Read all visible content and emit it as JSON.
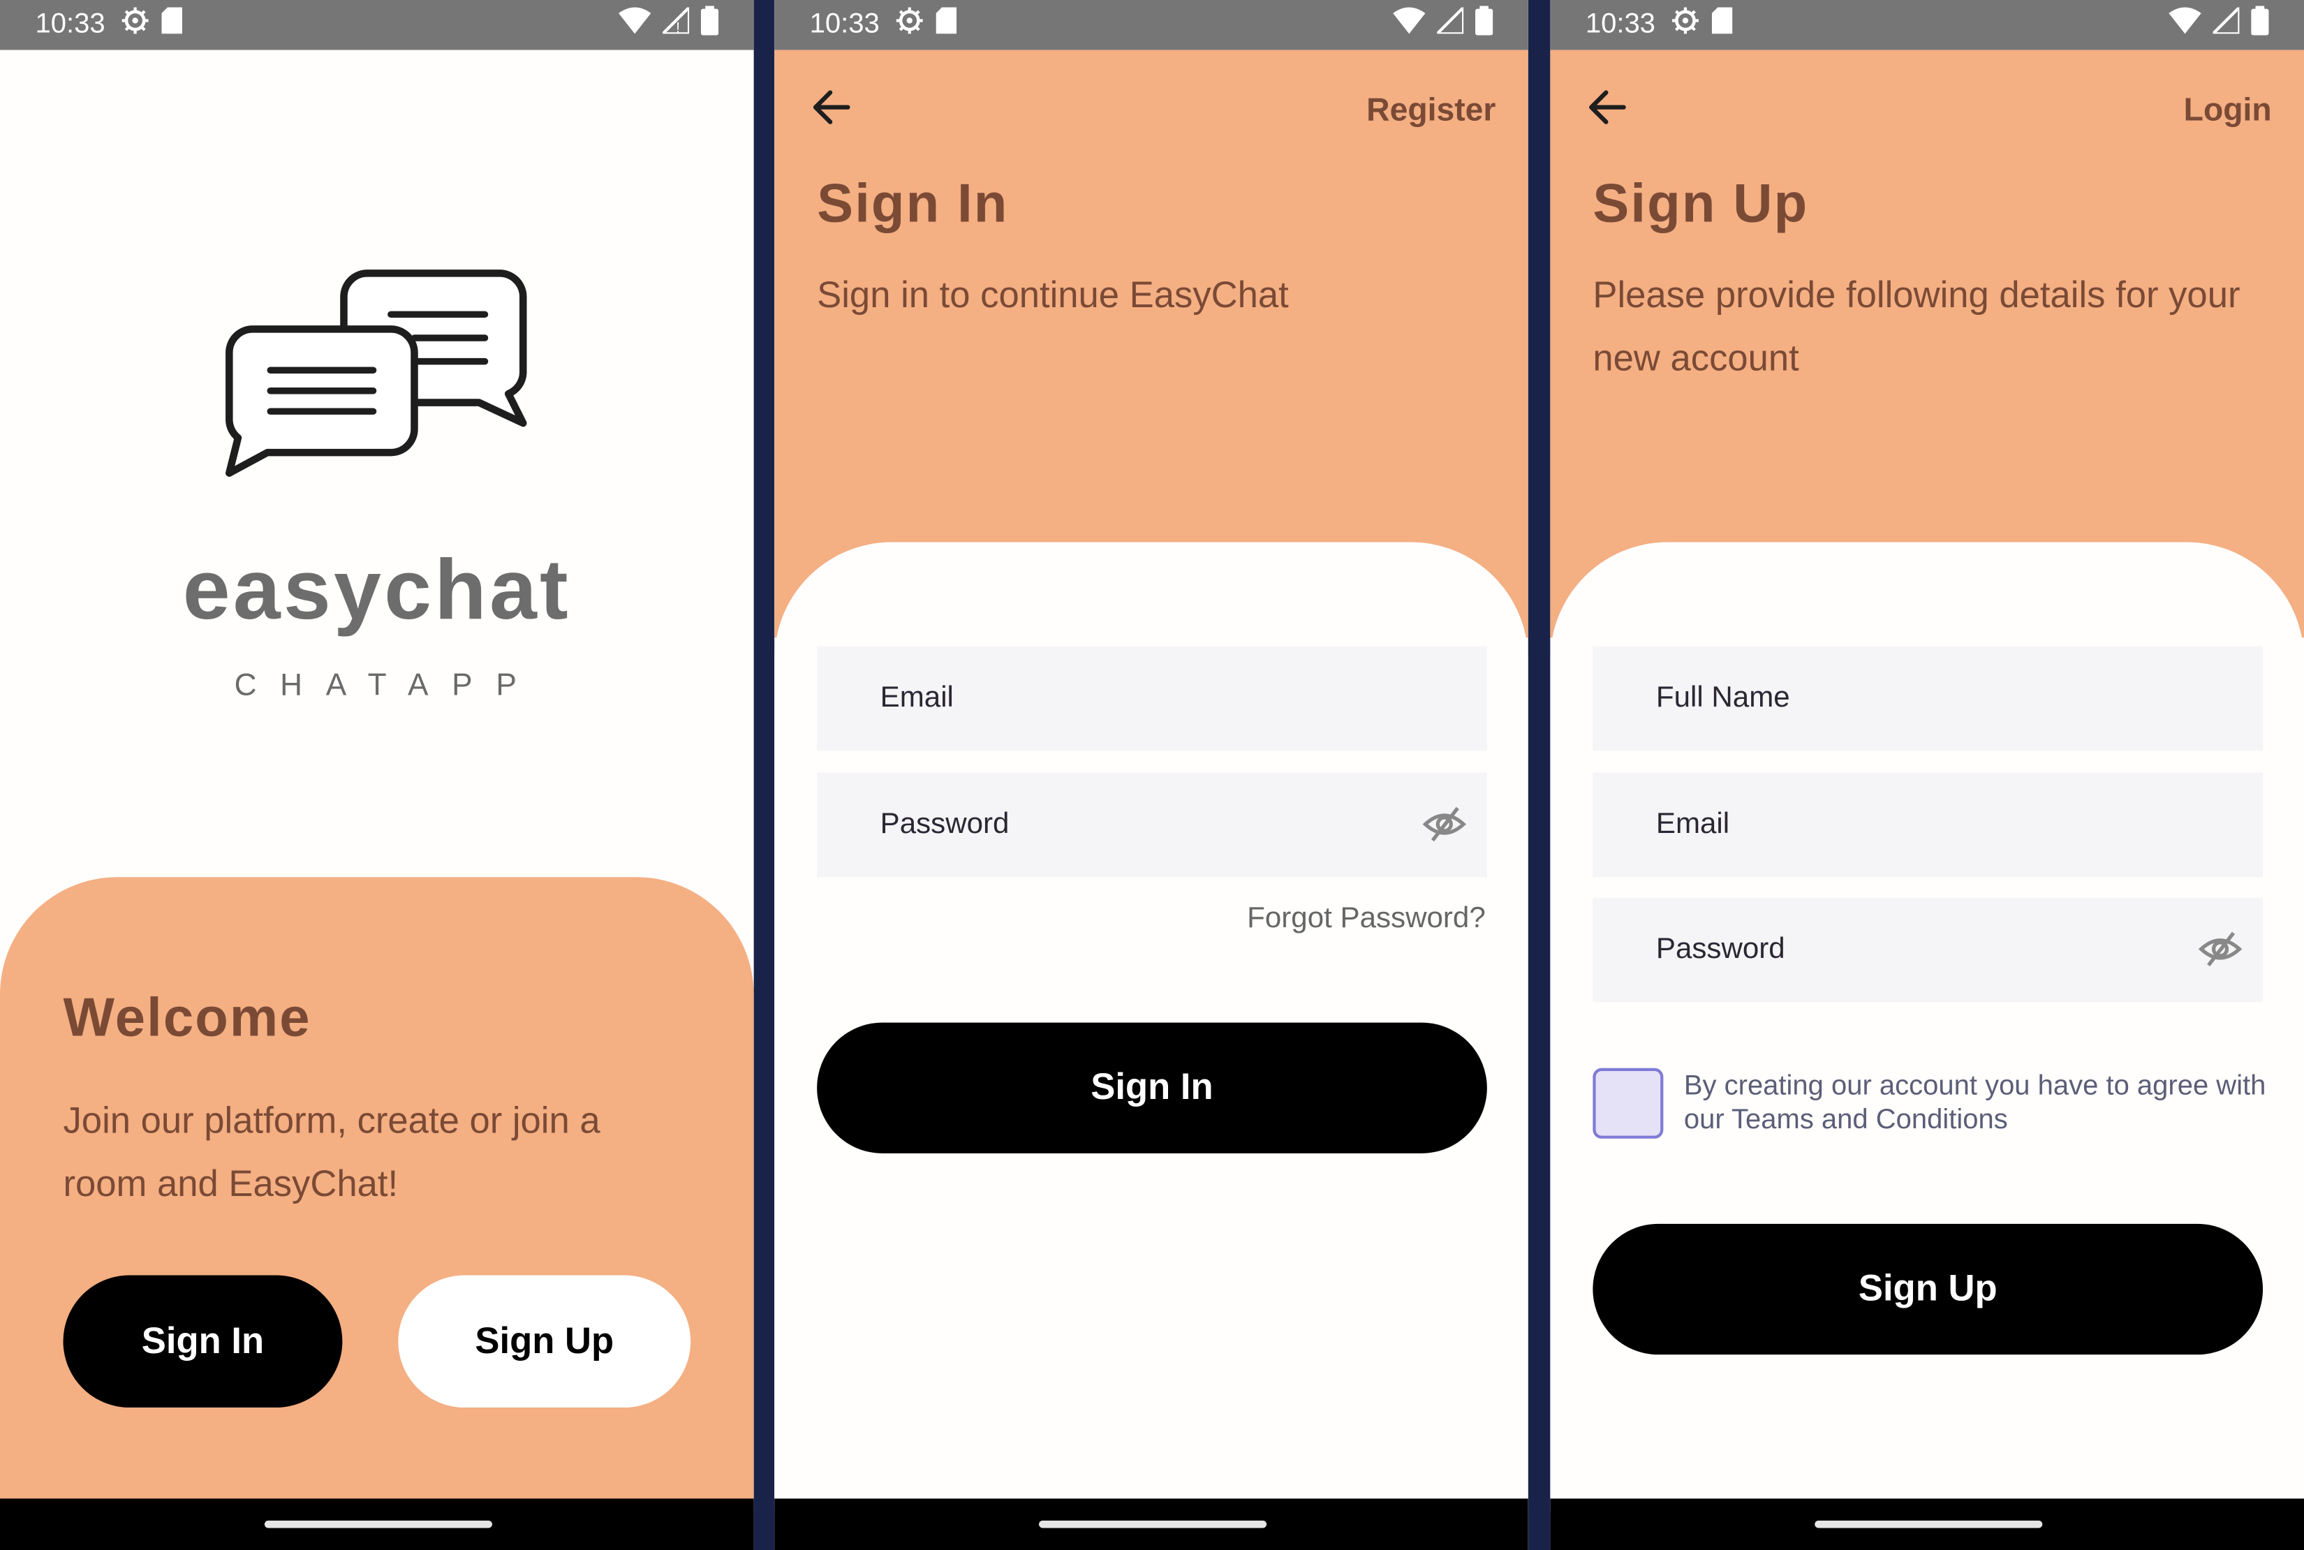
{
  "status_bar": {
    "time": "10:33"
  },
  "welcome_screen": {
    "brand": "easychat",
    "tagline": "CHATAPP",
    "title": "Welcome",
    "subtitle": "Join our platform, create or join a room and EasyChat!",
    "sign_in_label": "Sign In",
    "sign_up_label": "Sign Up"
  },
  "sign_in_screen": {
    "top_link": "Register",
    "title": "Sign In",
    "subtitle": "Sign in to continue EasyChat",
    "email_placeholder": "Email",
    "password_placeholder": "Password",
    "forgot_label": "Forgot Password?",
    "submit_label": "Sign In"
  },
  "sign_up_screen": {
    "top_link": "Login",
    "title": "Sign Up",
    "subtitle": "Please provide following details for your new account",
    "name_placeholder": "Full Name",
    "email_placeholder": "Email",
    "password_placeholder": "Password",
    "terms_text": "By creating our account you have to agree with our Teams and Conditions",
    "submit_label": "Sign Up"
  },
  "colors": {
    "accent_peach": "#f4af83",
    "heading_brown": "#7a4a35",
    "divider_navy": "#192349",
    "field_bg": "#f5f4f6"
  },
  "icons": [
    "settings-icon",
    "sd-card-icon",
    "wifi-icon",
    "signal-icon",
    "battery-icon",
    "chat-bubbles-icon",
    "back-arrow-icon",
    "eye-off-icon"
  ]
}
